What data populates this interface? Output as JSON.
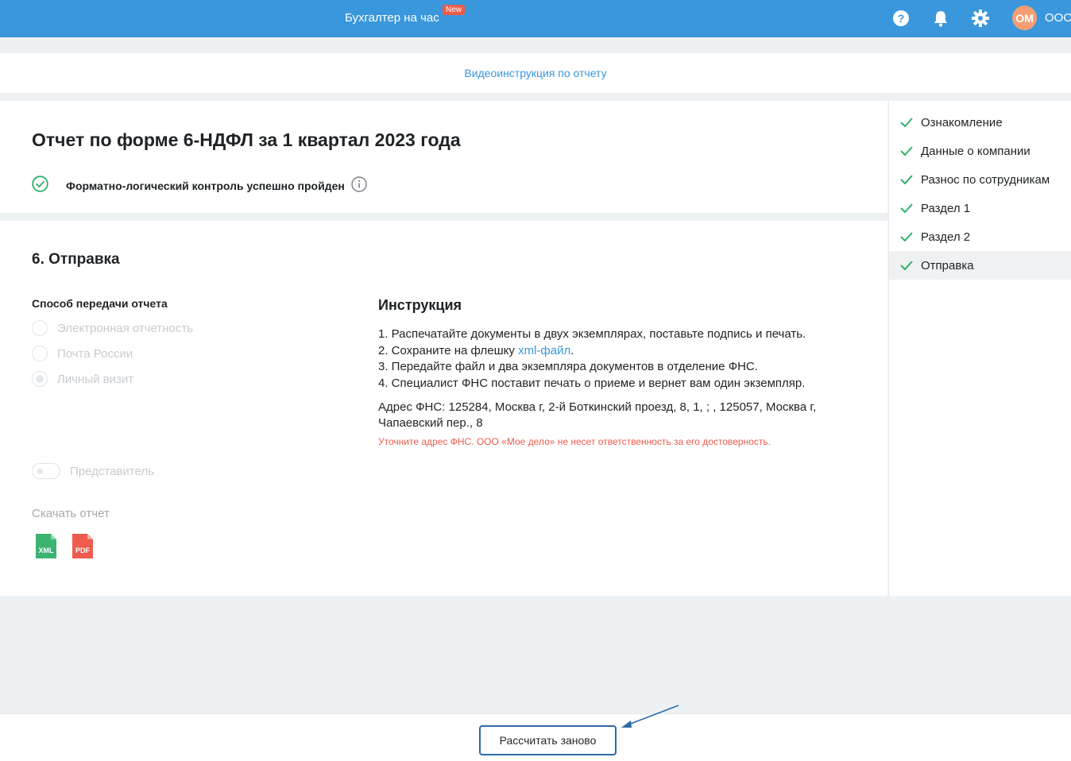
{
  "topbar": {
    "promo": "Бухгалтер на час",
    "promo_badge": "New",
    "avatar_initials": "ОМ",
    "org_name": "ООО"
  },
  "video_link": "Видеоинструкция по отчету",
  "report": {
    "title": "Отчет по форме 6-НДФЛ за 1 квартал 2023 года",
    "control_status": "Форматно-логический контроль успешно пройден"
  },
  "section": {
    "title": "6. Отправка",
    "method_label": "Способ передачи отчета",
    "methods": [
      {
        "label": "Электронная отчетность",
        "selected": false
      },
      {
        "label": "Почта России",
        "selected": false
      },
      {
        "label": "Личный визит",
        "selected": true
      }
    ],
    "representative_label": "Представитель",
    "download_label": "Скачать отчет",
    "files": [
      "XML",
      "PDF"
    ]
  },
  "instruction": {
    "title": "Инструкция",
    "step1": "1. Распечатайте документы в двух экземплярах, поставьте подпись и печать.",
    "step2_prefix": "2. Сохраните на флешку ",
    "step2_link": "xml-файл",
    "step2_suffix": ".",
    "step3": "3. Передайте файл и два экземпляра документов в отделение ФНС.",
    "step4": "4. Специалист ФНС поставит печать о приеме и вернет вам один экземпляр.",
    "address": "Адрес ФНС: 125284, Москва г, 2-й Боткинский проезд, 8, 1, ; , 125057, Москва г, Чапаевский пер., 8",
    "warning": "Уточните адрес ФНС. ООО «Мое дело» не несет ответственность за его достоверность."
  },
  "steps": [
    {
      "label": "Ознакомление",
      "active": false
    },
    {
      "label": "Данные о компании",
      "active": false
    },
    {
      "label": "Разнос по сотрудникам",
      "active": false
    },
    {
      "label": "Раздел 1",
      "active": false
    },
    {
      "label": "Раздел 2",
      "active": false
    },
    {
      "label": "Отправка",
      "active": true
    }
  ],
  "footer": {
    "recalc_label": "Рассчитать заново"
  },
  "colors": {
    "accent": "#3a97db",
    "success": "#2eb26b",
    "error": "#ef5b4c",
    "xml": "#3cb371",
    "pdf": "#ef5b4c"
  }
}
